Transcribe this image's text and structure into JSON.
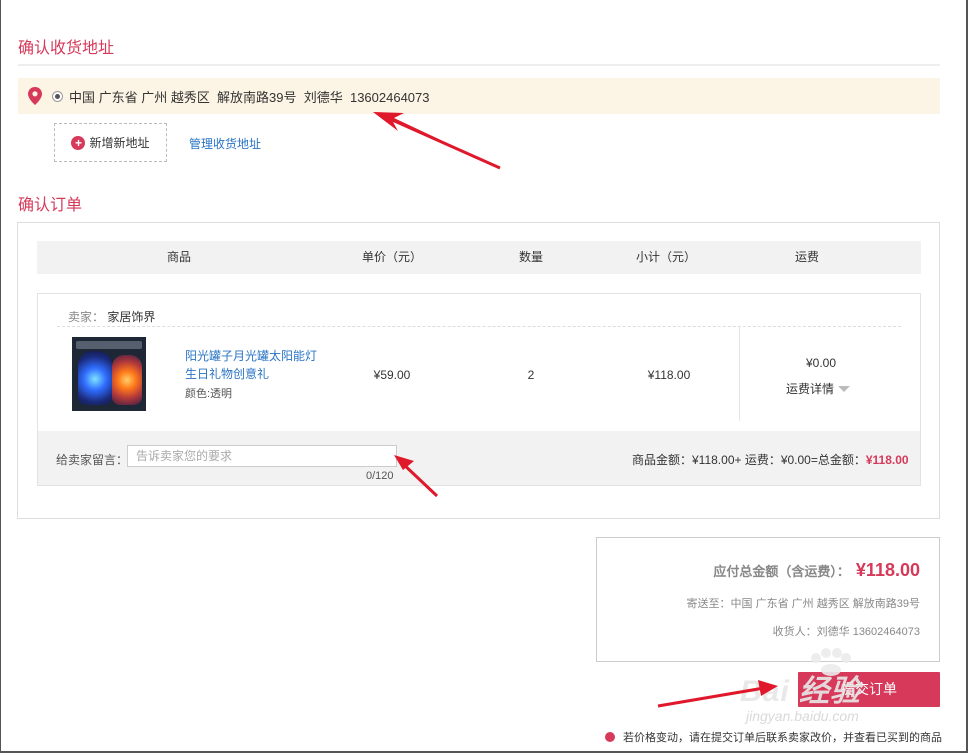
{
  "address_section": {
    "title": "确认收货地址",
    "selected_address": "中国 广东省 广州 越秀区  解放南路39号  刘德华  13602464073",
    "add_address_label": "新增新地址",
    "manage_address_label": "管理收货地址"
  },
  "order_section": {
    "title": "确认订单",
    "columns": [
      "商品",
      "单价（元）",
      "数量",
      "小计（元）",
      "运费"
    ],
    "seller_label": "卖家：",
    "seller_name": "家居饰界",
    "item": {
      "name": "阳光罐子月光罐太阳能灯 生日礼物创意礼",
      "color": "颜色:透明",
      "unit_price": "¥59.00",
      "quantity": "2",
      "subtotal": "¥118.00",
      "shipping_fee": "¥0.00",
      "shipping_detail_label": "运费详情"
    },
    "message": {
      "label": "给卖家留言：",
      "placeholder": "告诉卖家您的要求",
      "counter": "0/120"
    },
    "summary_prefix": "商品金额：¥118.00+ 运费：¥0.00=总金额：",
    "summary_total": "¥118.00"
  },
  "payment": {
    "total_label": "应付总金额（含运费）：",
    "total_amount": "¥118.00",
    "ship_to": "寄送至：中国 广东省 广州 越秀区 解放南路39号",
    "receiver": "收货人：刘德华 13602464073",
    "submit_label": "提交订单"
  },
  "notice": "若价格变动，请在提交订单后联系卖家改价，并查看已买到的商品",
  "watermark": {
    "main": "Bai  经验",
    "sub": "jingyan.baidu.com"
  },
  "colors": {
    "accent": "#d6395a",
    "link": "#2a74c6",
    "address_highlight": "#fcf4e4",
    "annotation_arrow": "#e0182b"
  },
  "icons": {
    "location": "map-pin-icon",
    "add": "plus-circle-icon",
    "expand": "triangle-down-icon",
    "notice": "dot-icon"
  }
}
